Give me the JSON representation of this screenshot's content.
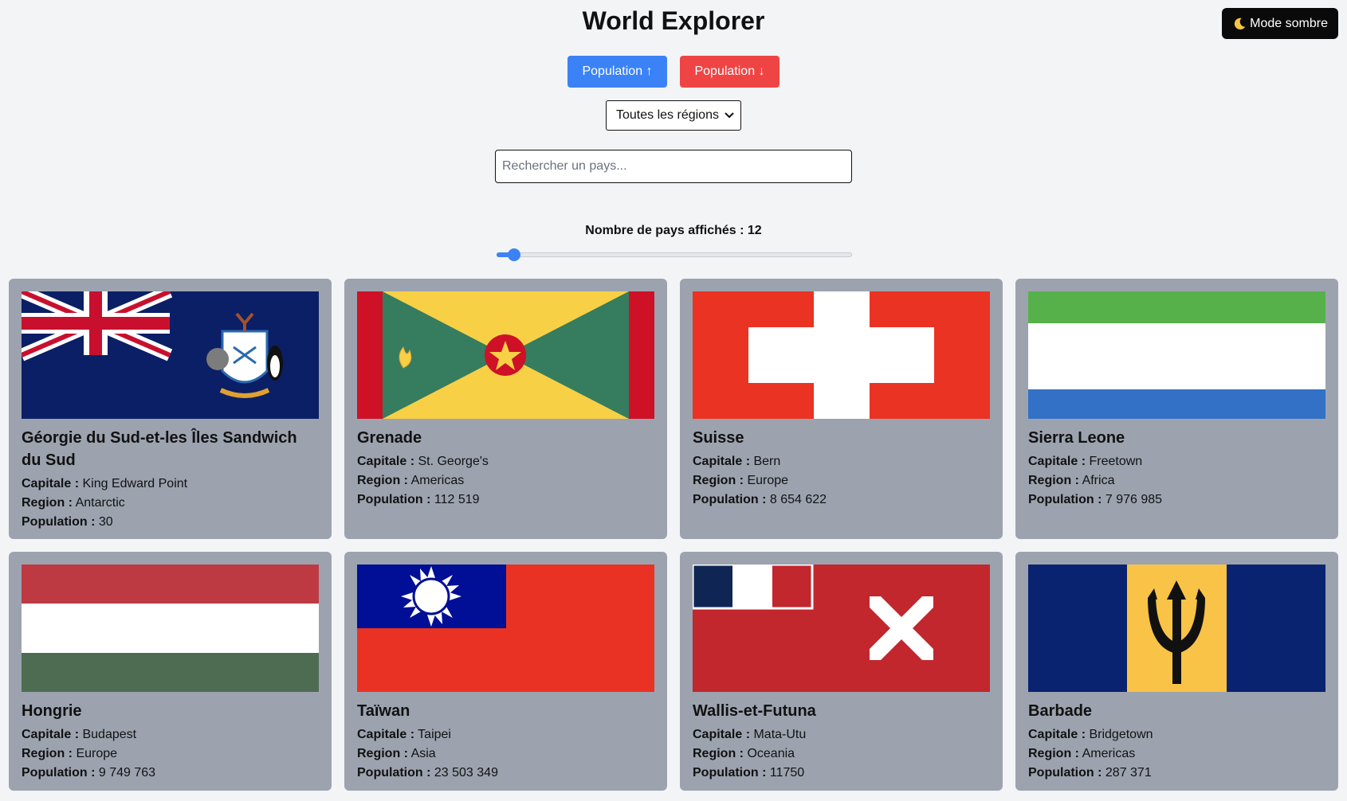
{
  "header": {
    "title": "World Explorer",
    "dark_mode_label": "Mode sombre"
  },
  "sort": {
    "asc_label": "Population ↑",
    "desc_label": "Population ↓"
  },
  "region_select": {
    "selected": "Toutes les régions"
  },
  "search": {
    "placeholder": "Rechercher un pays..."
  },
  "count": {
    "label": "Nombre de pays affichés : 12",
    "value": 12,
    "slider_fraction": 0.05
  },
  "labels": {
    "capital": "Capitale :",
    "region": "Region :",
    "population": "Population :"
  },
  "countries": [
    {
      "name": "Géorgie du Sud-et-les Îles Sandwich du Sud",
      "capital": "King Edward Point",
      "region": "Antarctic",
      "population": "30",
      "flag": "sgs"
    },
    {
      "name": "Grenade",
      "capital": "St. George's",
      "region": "Americas",
      "population": "112 519",
      "flag": "grd"
    },
    {
      "name": "Suisse",
      "capital": "Bern",
      "region": "Europe",
      "population": "8 654 622",
      "flag": "che"
    },
    {
      "name": "Sierra Leone",
      "capital": "Freetown",
      "region": "Africa",
      "population": "7 976 985",
      "flag": "sle"
    },
    {
      "name": "Hongrie",
      "capital": "Budapest",
      "region": "Europe",
      "population": "9 749 763",
      "flag": "hun"
    },
    {
      "name": "Taïwan",
      "capital": "Taipei",
      "region": "Asia",
      "population": "23 503 349",
      "flag": "twn"
    },
    {
      "name": "Wallis-et-Futuna",
      "capital": "Mata-Utu",
      "region": "Oceania",
      "population": "11750",
      "flag": "wlf"
    },
    {
      "name": "Barbade",
      "capital": "Bridgetown",
      "region": "Americas",
      "population": "287 371",
      "flag": "brb"
    }
  ],
  "icons": {
    "dark_mode": "moon-icon",
    "select": "chevron-down-icon"
  }
}
